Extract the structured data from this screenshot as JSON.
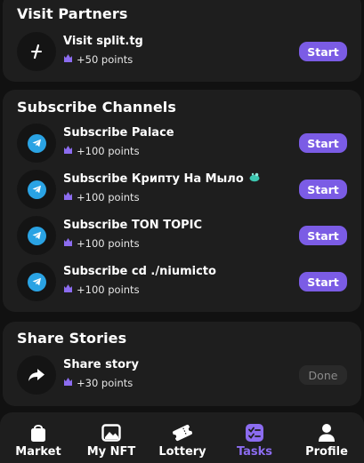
{
  "sections": {
    "partners": {
      "title": "Visit Partners",
      "tasks": [
        {
          "title": "Visit split.tg",
          "points": "+50 points",
          "action": "Start"
        }
      ]
    },
    "channels": {
      "title": "Subscribe Channels",
      "tasks": [
        {
          "title": "Subscribe Palace",
          "points": "+100 points",
          "action": "Start"
        },
        {
          "title": "Subscribe Крипту На Мыло",
          "points": "+100 points",
          "action": "Start"
        },
        {
          "title": "Subscribe TON TOPIC",
          "points": "+100 points",
          "action": "Start"
        },
        {
          "title": "Subscribe cd ./niumicto",
          "points": "+100 points",
          "action": "Start"
        }
      ]
    },
    "stories": {
      "title": "Share Stories",
      "tasks": [
        {
          "title": "Share story",
          "points": "+30 points",
          "action": "Done"
        }
      ]
    }
  },
  "nav": {
    "items": [
      {
        "label": "Market",
        "icon": "bag-icon"
      },
      {
        "label": "My NFT",
        "icon": "image-icon"
      },
      {
        "label": "Lottery",
        "icon": "ticket-icon"
      },
      {
        "label": "Tasks",
        "icon": "tasks-icon",
        "active": true
      },
      {
        "label": "Profile",
        "icon": "profile-icon"
      }
    ]
  },
  "colors": {
    "accent": "#7b5ce5",
    "active_nav": "#8c6cf0",
    "telegram": "#2aa3e4",
    "card": "#1e1e1e",
    "background": "#111111"
  }
}
